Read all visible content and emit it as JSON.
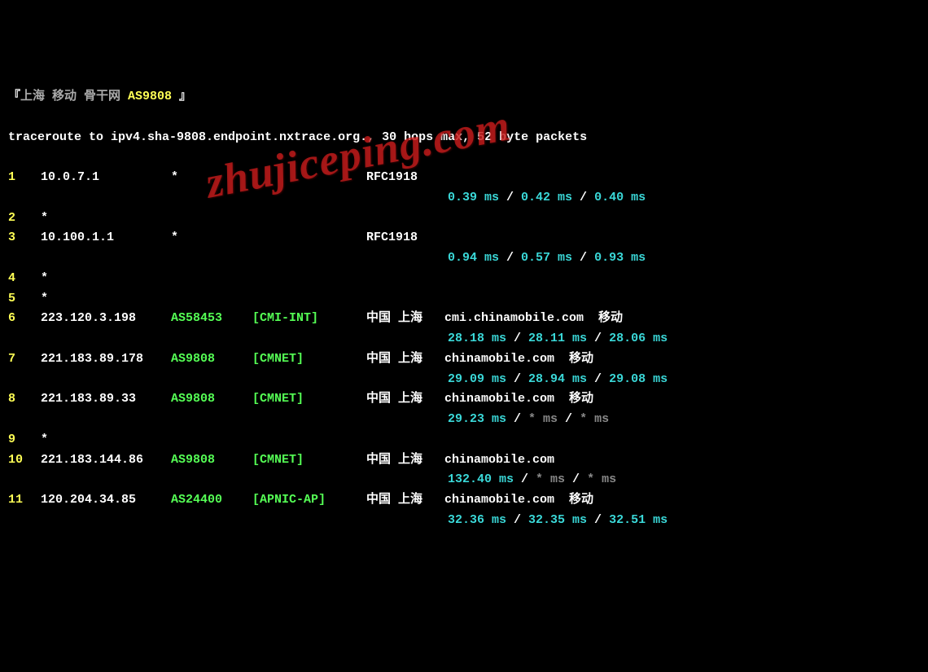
{
  "header": {
    "open_bracket": "『",
    "close_bracket": " 』",
    "location": "上海 移动 骨干网 ",
    "asn": "AS9808"
  },
  "command": "traceroute to ipv4.sha-9808.endpoint.nxtrace.org., 30 hops max, 52 byte packets",
  "hops": [
    {
      "num": "1",
      "ip": "10.0.7.1",
      "asn": "*",
      "tag": "",
      "geo_rfc": "RFC1918",
      "lat": [
        "0.39 ms",
        "0.42 ms",
        "0.40 ms"
      ],
      "lat_grey": [
        false,
        false,
        false
      ]
    },
    {
      "num": "2",
      "ip": "*"
    },
    {
      "num": "3",
      "ip": "10.100.1.1",
      "asn": "*",
      "tag": "",
      "geo_rfc": "RFC1918",
      "lat": [
        "0.94 ms",
        "0.57 ms",
        "0.93 ms"
      ],
      "lat_grey": [
        false,
        false,
        false
      ]
    },
    {
      "num": "4",
      "ip": "*"
    },
    {
      "num": "5",
      "ip": "*"
    },
    {
      "num": "6",
      "ip": "223.120.3.198",
      "asn": "AS58453",
      "tag": "[CMI-INT]",
      "geo": "中国 上海   cmi.chinamobile.com  移动",
      "lat": [
        "28.18 ms",
        "28.11 ms",
        "28.06 ms"
      ],
      "lat_grey": [
        false,
        false,
        false
      ]
    },
    {
      "num": "7",
      "ip": "221.183.89.178",
      "asn": "AS9808",
      "tag": "[CMNET]",
      "geo": "中国 上海   chinamobile.com  移动",
      "lat": [
        "29.09 ms",
        "28.94 ms",
        "29.08 ms"
      ],
      "lat_grey": [
        false,
        false,
        false
      ]
    },
    {
      "num": "8",
      "ip": "221.183.89.33",
      "asn": "AS9808",
      "tag": "[CMNET]",
      "geo": "中国 上海   chinamobile.com  移动",
      "lat": [
        "29.23 ms",
        "* ms",
        "* ms"
      ],
      "lat_grey": [
        false,
        true,
        true
      ]
    },
    {
      "num": "9",
      "ip": "*"
    },
    {
      "num": "10",
      "ip": "221.183.144.86",
      "asn": "AS9808",
      "tag": "[CMNET]",
      "geo": "中国 上海   chinamobile.com",
      "lat": [
        "132.40 ms",
        "* ms",
        "* ms"
      ],
      "lat_grey": [
        false,
        true,
        true
      ]
    },
    {
      "num": "11",
      "ip": "120.204.34.85",
      "asn": "AS24400",
      "tag": "[APNIC-AP]",
      "geo": "中国 上海   chinamobile.com  移动",
      "lat": [
        "32.36 ms",
        "32.35 ms",
        "32.51 ms"
      ],
      "lat_grey": [
        false,
        false,
        false
      ]
    }
  ],
  "separator": " / ",
  "watermark": "zhujiceping.com"
}
